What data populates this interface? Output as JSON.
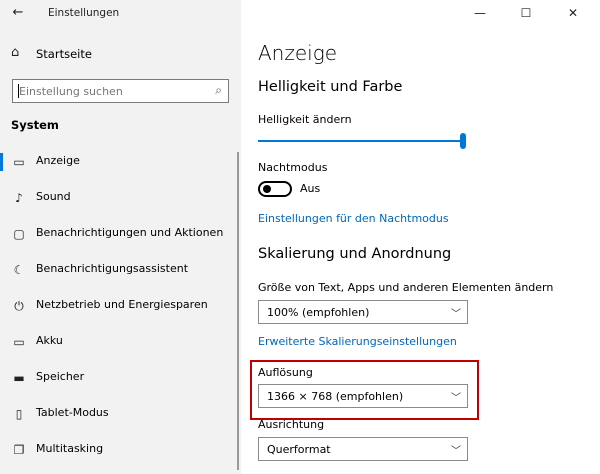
{
  "window": {
    "title": "Einstellungen",
    "back_glyph": "←",
    "minimize_glyph": "—",
    "maximize_glyph": "☐",
    "close_glyph": "✕"
  },
  "sidebar": {
    "home_label": "Startseite",
    "home_icon": "home-icon",
    "search_placeholder": "Einstellung suchen",
    "search_icon": "search-icon",
    "section": "System",
    "items": [
      {
        "label": "Anzeige",
        "icon": "monitor-icon",
        "glyph": "▭",
        "selected": true
      },
      {
        "label": "Sound",
        "icon": "speaker-icon",
        "glyph": "♪"
      },
      {
        "label": "Benachrichtigungen und Aktionen",
        "icon": "message-icon",
        "glyph": "▢"
      },
      {
        "label": "Benachrichtigungsassistent",
        "icon": "moon-icon",
        "glyph": "☾"
      },
      {
        "label": "Netzbetrieb und Energiesparen",
        "icon": "power-icon",
        "glyph": "⏻"
      },
      {
        "label": "Akku",
        "icon": "battery-icon",
        "glyph": "▭"
      },
      {
        "label": "Speicher",
        "icon": "storage-icon",
        "glyph": "▬"
      },
      {
        "label": "Tablet-Modus",
        "icon": "tablet-icon",
        "glyph": "▯"
      },
      {
        "label": "Multitasking",
        "icon": "multitasking-icon",
        "glyph": "❐"
      }
    ]
  },
  "main": {
    "page_title": "Anzeige",
    "brightness_section": "Helligkeit und Farbe",
    "brightness_label": "Helligkeit ändern",
    "brightness_value": 1.0,
    "nightmode_label": "Nachtmodus",
    "nightmode_state": "Aus",
    "nightmode_link": "Einstellungen für den Nachtmodus",
    "scaling_section": "Skalierung und Anordnung",
    "scale_label": "Größe von Text, Apps und anderen Elementen ändern",
    "scale_value": "100% (empfohlen)",
    "scale_link": "Erweiterte Skalierungseinstellungen",
    "resolution_label": "Auflösung",
    "resolution_value": "1366 × 768 (empfohlen)",
    "orientation_label": "Ausrichtung",
    "orientation_value": "Querformat",
    "chevron_glyph": "﹀"
  },
  "colors": {
    "accent": "#0078d7",
    "link": "#0067b8",
    "highlight": "#c00000",
    "sidebar_bg": "#f2f2f2"
  }
}
